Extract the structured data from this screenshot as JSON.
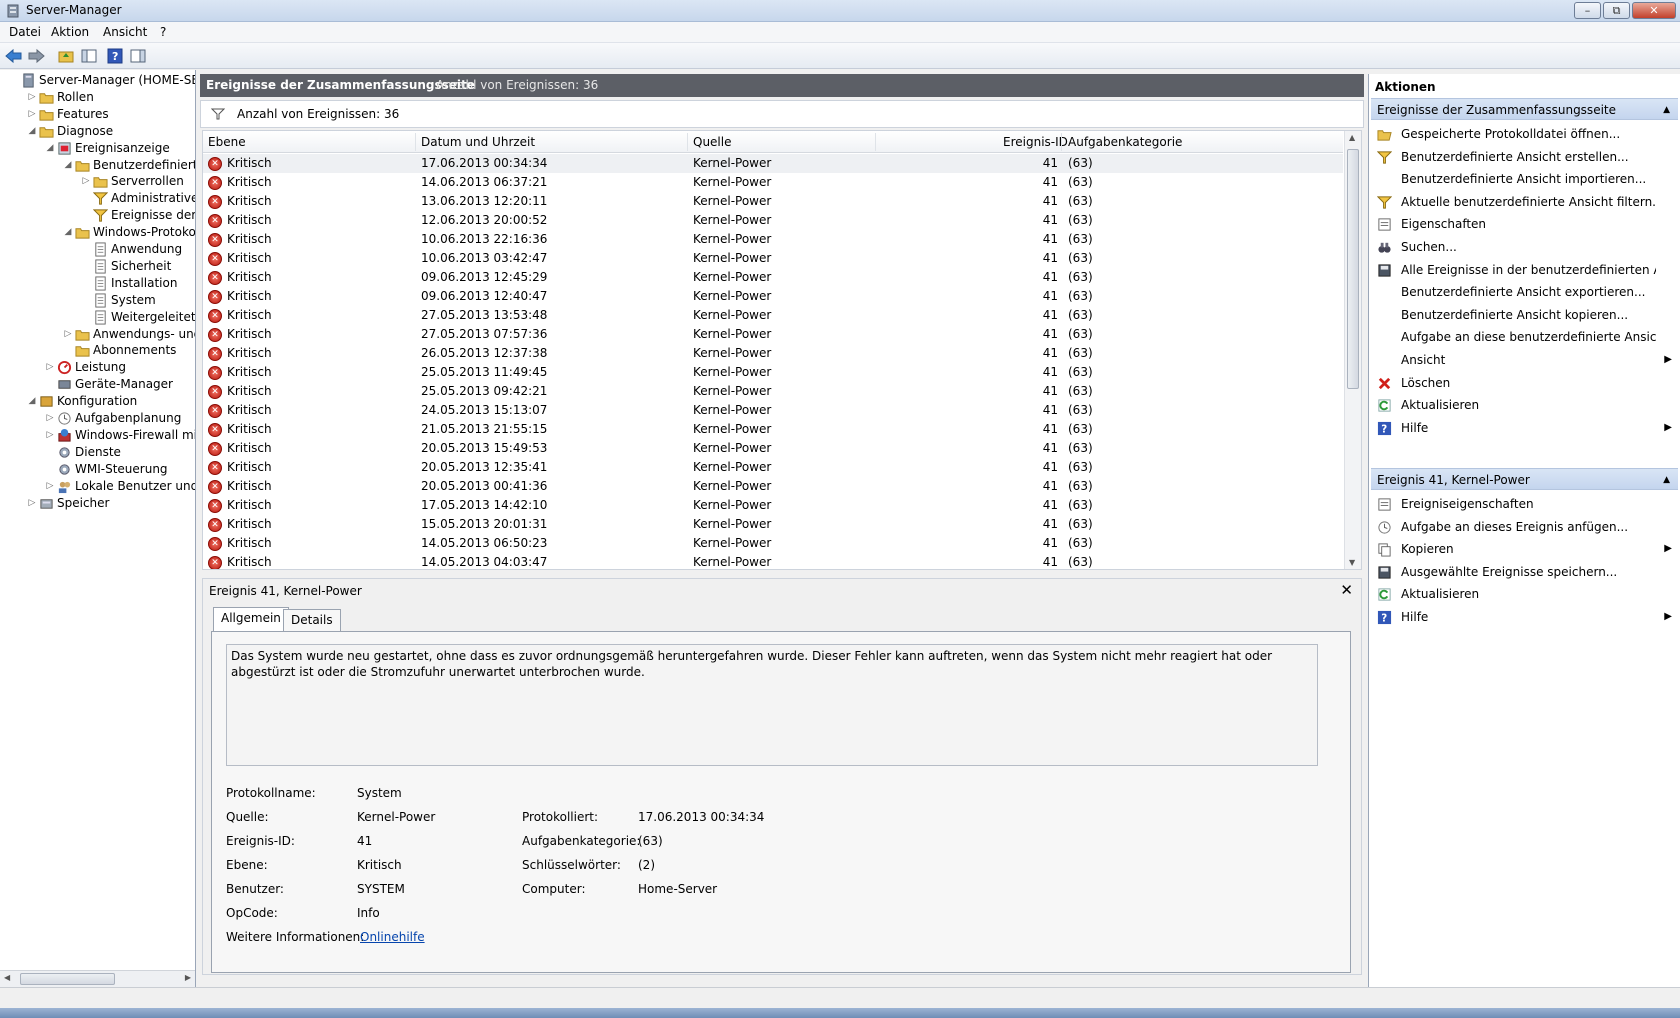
{
  "window": {
    "title": "Server-Manager",
    "minimize": "–",
    "restore": "⧉",
    "close": "✕"
  },
  "menu": [
    "Datei",
    "Aktion",
    "Ansicht",
    "?"
  ],
  "tree": [
    {
      "label": "Server-Manager (HOME-SERVER)",
      "depth": 0,
      "exp": ""
    },
    {
      "label": "Rollen",
      "depth": 1,
      "exp": "▷"
    },
    {
      "label": "Features",
      "depth": 1,
      "exp": "▷"
    },
    {
      "label": "Diagnose",
      "depth": 1,
      "exp": "◢"
    },
    {
      "label": "Ereignisanzeige",
      "depth": 2,
      "exp": "◢"
    },
    {
      "label": "Benutzerdefinierte Ansichten",
      "depth": 3,
      "exp": "◢"
    },
    {
      "label": "Serverrollen",
      "depth": 4,
      "exp": "▷"
    },
    {
      "label": "Administrative Ereignisse",
      "depth": 4,
      "exp": ""
    },
    {
      "label": "Ereignisse der Zusammenfassungsseite",
      "depth": 4,
      "exp": ""
    },
    {
      "label": "Windows-Protokolle",
      "depth": 3,
      "exp": "◢"
    },
    {
      "label": "Anwendung",
      "depth": 4,
      "exp": ""
    },
    {
      "label": "Sicherheit",
      "depth": 4,
      "exp": ""
    },
    {
      "label": "Installation",
      "depth": 4,
      "exp": ""
    },
    {
      "label": "System",
      "depth": 4,
      "exp": ""
    },
    {
      "label": "Weitergeleitete Ereignisse",
      "depth": 4,
      "exp": ""
    },
    {
      "label": "Anwendungs- und Dienstprotokolle",
      "depth": 3,
      "exp": "▷"
    },
    {
      "label": "Abonnements",
      "depth": 3,
      "exp": ""
    },
    {
      "label": "Leistung",
      "depth": 2,
      "exp": "▷"
    },
    {
      "label": "Geräte-Manager",
      "depth": 2,
      "exp": ""
    },
    {
      "label": "Konfiguration",
      "depth": 1,
      "exp": "◢"
    },
    {
      "label": "Aufgabenplanung",
      "depth": 2,
      "exp": "▷"
    },
    {
      "label": "Windows-Firewall mit erweiterter Sicherheit",
      "depth": 2,
      "exp": "▷"
    },
    {
      "label": "Dienste",
      "depth": 2,
      "exp": ""
    },
    {
      "label": "WMI-Steuerung",
      "depth": 2,
      "exp": ""
    },
    {
      "label": "Lokale Benutzer und Gruppen",
      "depth": 2,
      "exp": "▷"
    },
    {
      "label": "Speicher",
      "depth": 1,
      "exp": "▷"
    }
  ],
  "center": {
    "header_title": "Ereignisse der Zusammenfassungsseite",
    "header_count": "Anzahl von Ereignissen: 36",
    "filter_text": "Anzahl von Ereignissen: 36"
  },
  "grid": {
    "columns": [
      "Ebene",
      "Datum und Uhrzeit",
      "Quelle",
      "Ereignis-ID",
      "Aufgabenkategorie"
    ],
    "rows": [
      [
        "Kritisch",
        "17.06.2013 00:34:34",
        "Kernel-Power",
        "41",
        "(63)"
      ],
      [
        "Kritisch",
        "14.06.2013 06:37:21",
        "Kernel-Power",
        "41",
        "(63)"
      ],
      [
        "Kritisch",
        "13.06.2013 12:20:11",
        "Kernel-Power",
        "41",
        "(63)"
      ],
      [
        "Kritisch",
        "12.06.2013 20:00:52",
        "Kernel-Power",
        "41",
        "(63)"
      ],
      [
        "Kritisch",
        "10.06.2013 22:16:36",
        "Kernel-Power",
        "41",
        "(63)"
      ],
      [
        "Kritisch",
        "10.06.2013 03:42:47",
        "Kernel-Power",
        "41",
        "(63)"
      ],
      [
        "Kritisch",
        "09.06.2013 12:45:29",
        "Kernel-Power",
        "41",
        "(63)"
      ],
      [
        "Kritisch",
        "09.06.2013 12:40:47",
        "Kernel-Power",
        "41",
        "(63)"
      ],
      [
        "Kritisch",
        "27.05.2013 13:53:48",
        "Kernel-Power",
        "41",
        "(63)"
      ],
      [
        "Kritisch",
        "27.05.2013 07:57:36",
        "Kernel-Power",
        "41",
        "(63)"
      ],
      [
        "Kritisch",
        "26.05.2013 12:37:38",
        "Kernel-Power",
        "41",
        "(63)"
      ],
      [
        "Kritisch",
        "25.05.2013 11:49:45",
        "Kernel-Power",
        "41",
        "(63)"
      ],
      [
        "Kritisch",
        "25.05.2013 09:42:21",
        "Kernel-Power",
        "41",
        "(63)"
      ],
      [
        "Kritisch",
        "24.05.2013 15:13:07",
        "Kernel-Power",
        "41",
        "(63)"
      ],
      [
        "Kritisch",
        "21.05.2013 21:55:15",
        "Kernel-Power",
        "41",
        "(63)"
      ],
      [
        "Kritisch",
        "20.05.2013 15:49:53",
        "Kernel-Power",
        "41",
        "(63)"
      ],
      [
        "Kritisch",
        "20.05.2013 12:35:41",
        "Kernel-Power",
        "41",
        "(63)"
      ],
      [
        "Kritisch",
        "20.05.2013 00:41:36",
        "Kernel-Power",
        "41",
        "(63)"
      ],
      [
        "Kritisch",
        "17.05.2013 14:42:10",
        "Kernel-Power",
        "41",
        "(63)"
      ],
      [
        "Kritisch",
        "15.05.2013 20:01:31",
        "Kernel-Power",
        "41",
        "(63)"
      ],
      [
        "Kritisch",
        "14.05.2013 06:50:23",
        "Kernel-Power",
        "41",
        "(63)"
      ],
      [
        "Kritisch",
        "14.05.2013 04:03:47",
        "Kernel-Power",
        "41",
        "(63)"
      ]
    ]
  },
  "detail": {
    "title": "Ereignis 41, Kernel-Power",
    "close": "✕",
    "tabs": [
      "Allgemein",
      "Details"
    ],
    "description": "Das System wurde neu gestartet, ohne dass es zuvor ordnungsgemäß heruntergefahren wurde. Dieser Fehler kann auftreten, wenn das System nicht mehr reagiert hat oder abgestürzt ist oder die Stromzufuhr unerwartet unterbrochen wurde.",
    "props": {
      "protokollname_label": "Protokollname:",
      "protokollname": "System",
      "quelle_label": "Quelle:",
      "quelle": "Kernel-Power",
      "protokolliert_label": "Protokolliert:",
      "protokolliert": "17.06.2013 00:34:34",
      "ereignisid_label": "Ereignis-ID:",
      "ereignisid": "41",
      "aufgabenkategorie_label": "Aufgabenkategorie:",
      "aufgabenkategorie": "(63)",
      "ebene_label": "Ebene:",
      "ebene": "Kritisch",
      "schluessel_label": "Schlüsselwörter:",
      "schluessel": "(2)",
      "benutzer_label": "Benutzer:",
      "benutzer": "SYSTEM",
      "computer_label": "Computer:",
      "computer": "Home-Server",
      "opcode_label": "OpCode:",
      "opcode": "Info",
      "weitere_label": "Weitere Informationen:",
      "weitere_link": "Onlinehilfe"
    }
  },
  "actions": {
    "title": "Aktionen",
    "section1": "Ereignisse der Zusammenfassungsseite",
    "items1": [
      {
        "label": "Gespeicherte Protokolldatei öffnen...",
        "icon": "folder-open-icon",
        "sub": ""
      },
      {
        "label": "Benutzerdefinierte Ansicht erstellen...",
        "icon": "filter-icon",
        "sub": ""
      },
      {
        "label": "Benutzerdefinierte Ansicht importieren...",
        "icon": "",
        "sub": ""
      },
      {
        "label": "Aktuelle benutzerdefinierte Ansicht filtern...",
        "icon": "filter-icon",
        "sub": ""
      },
      {
        "label": "Eigenschaften",
        "icon": "properties-icon",
        "sub": ""
      },
      {
        "label": "Suchen...",
        "icon": "binoculars-icon",
        "sub": ""
      },
      {
        "label": "Alle Ereignisse in der benutzerdefinierten Ansi...",
        "icon": "save-icon",
        "sub": ""
      },
      {
        "label": "Benutzerdefinierte Ansicht exportieren...",
        "icon": "",
        "sub": ""
      },
      {
        "label": "Benutzerdefinierte Ansicht kopieren...",
        "icon": "",
        "sub": ""
      },
      {
        "label": "Aufgabe an diese benutzerdefinierte Ansicht a...",
        "icon": "",
        "sub": ""
      },
      {
        "label": "Ansicht",
        "icon": "",
        "sub": "▶"
      },
      {
        "label": "Löschen",
        "icon": "delete-icon",
        "sub": ""
      },
      {
        "label": "Aktualisieren",
        "icon": "refresh-icon",
        "sub": ""
      },
      {
        "label": "Hilfe",
        "icon": "help-icon",
        "sub": "▶"
      }
    ],
    "section2": "Ereignis 41, Kernel-Power",
    "items2": [
      {
        "label": "Ereigniseigenschaften",
        "icon": "properties-icon",
        "sub": ""
      },
      {
        "label": "Aufgabe an dieses Ereignis anfügen...",
        "icon": "task-icon",
        "sub": ""
      },
      {
        "label": "Kopieren",
        "icon": "copy-icon",
        "sub": "▶"
      },
      {
        "label": "Ausgewählte Ereignisse speichern...",
        "icon": "save-icon",
        "sub": ""
      },
      {
        "label": "Aktualisieren",
        "icon": "refresh-icon",
        "sub": ""
      },
      {
        "label": "Hilfe",
        "icon": "help-icon",
        "sub": "▶"
      }
    ]
  },
  "colors": {
    "header_bg": "#5c5f66",
    "section_bg": "#c4d5ee",
    "error_red": "#c0392b",
    "link": "#0645ad"
  }
}
